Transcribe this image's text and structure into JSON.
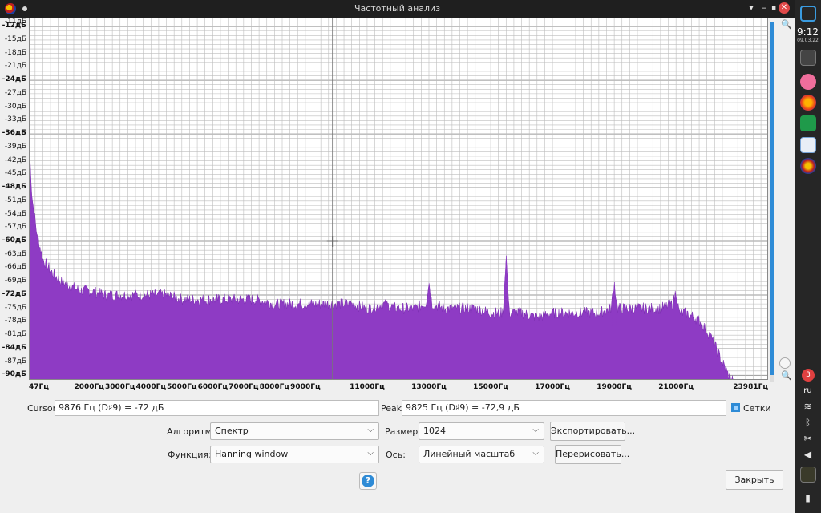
{
  "window": {
    "title": "Частотный анализ"
  },
  "chart_data": {
    "type": "area",
    "title": "",
    "xlabel": "",
    "ylabel": "",
    "xlim": [
      47,
      23981
    ],
    "ylim": [
      -91,
      -10
    ],
    "grid": true,
    "y_tick_labels": [
      "-11дБ",
      "-12дБ",
      "-15дБ",
      "-18дБ",
      "-21дБ",
      "-24дБ",
      "-27дБ",
      "-30дБ",
      "-33дБ",
      "-36дБ",
      "-39дБ",
      "-42дБ",
      "-45дБ",
      "-48дБ",
      "-51дБ",
      "-54дБ",
      "-57дБ",
      "-60дБ",
      "-63дБ",
      "-66дБ",
      "-69дБ",
      "-72дБ",
      "-75дБ",
      "-78дБ",
      "-81дБ",
      "-84дБ",
      "-87дБ",
      "-90дБ"
    ],
    "y_tick_values": [
      -11,
      -12,
      -15,
      -18,
      -21,
      -24,
      -27,
      -30,
      -33,
      -36,
      -39,
      -42,
      -45,
      -48,
      -51,
      -54,
      -57,
      -60,
      -63,
      -66,
      -69,
      -72,
      -75,
      -78,
      -81,
      -84,
      -87,
      -90
    ],
    "y_major_values": [
      -12,
      -24,
      -36,
      -48,
      -60,
      -72,
      -84,
      -90
    ],
    "x_tick_labels": [
      "47Гц",
      "2000Гц",
      "3000Гц",
      "4000Гц",
      "5000Гц",
      "6000Гц",
      "7000Гц",
      "8000Гц",
      "9000Гц",
      "11000Гц",
      "13000Гц",
      "15000Гц",
      "17000Гц",
      "19000Гц",
      "21000Гц",
      "23981Гц"
    ],
    "x_tick_values": [
      47,
      2000,
      3000,
      4000,
      5000,
      6000,
      7000,
      8000,
      9000,
      11000,
      13000,
      15000,
      17000,
      19000,
      21000,
      23981
    ],
    "series": [
      {
        "x": [
          47,
          150,
          300,
          500,
          800,
          1100,
          1400,
          1700,
          2000,
          2500,
          3000,
          3500,
          4000,
          4500,
          5000,
          5500,
          6000,
          6500,
          7000,
          7500,
          8000,
          8500,
          9000,
          9500,
          10000,
          10500,
          11000,
          11500,
          12000,
          12500,
          12900,
          13000,
          13100,
          13500,
          14000,
          14500,
          15000,
          15400,
          15500,
          15600,
          16000,
          16500,
          17000,
          17500,
          18000,
          18500,
          18900,
          19000,
          19100,
          19500,
          20000,
          20500,
          20900,
          21000,
          21100,
          21300,
          21600,
          21800,
          21900,
          22100,
          22300,
          22500,
          22700,
          22850
        ],
        "y": [
          -36,
          -50,
          -58,
          -64,
          -67,
          -69,
          -70,
          -71,
          -71,
          -72,
          -72,
          -72,
          -72,
          -72,
          -73,
          -73,
          -73,
          -73,
          -73,
          -73,
          -74,
          -74,
          -74,
          -74,
          -74,
          -74,
          -75,
          -74,
          -75,
          -75,
          -74,
          -69,
          -74,
          -75,
          -75,
          -75,
          -76,
          -76,
          -63,
          -76,
          -76,
          -77,
          -76,
          -76,
          -76,
          -76,
          -75,
          -69,
          -75,
          -75,
          -75,
          -75,
          -74,
          -71,
          -76,
          -76,
          -77,
          -78,
          -79,
          -81,
          -84,
          -87,
          -90,
          -91
        ]
      }
    ],
    "colors": {
      "fill": "#8e3bc4",
      "grid": "#bdbdbd",
      "background": "#ffffff"
    }
  },
  "controls": {
    "cursor_label": "Cursor:",
    "cursor_value": "9876 Гц (D♯9) = -72 дБ",
    "peak_label": "Peak:",
    "peak_value": "9825 Гц (D♯9) = -72,9 дБ",
    "grid_label": "Сетки",
    "algorithm_label": "Алгоритм:",
    "algorithm_value": "Спектр",
    "function_label": "Функция:",
    "function_value": "Hanning window",
    "size_label": "Размер:",
    "size_value": "1024",
    "axis_label": "Ось:",
    "axis_value": "Линейный масштаб",
    "export_label": "Экспортировать...",
    "redraw_label": "Перерисовать...",
    "close_label": "Закрыть",
    "help_glyph": "?"
  },
  "panel": {
    "time": "9:12",
    "date": "09.03.22",
    "lang": "ru",
    "notif_count": "3"
  }
}
